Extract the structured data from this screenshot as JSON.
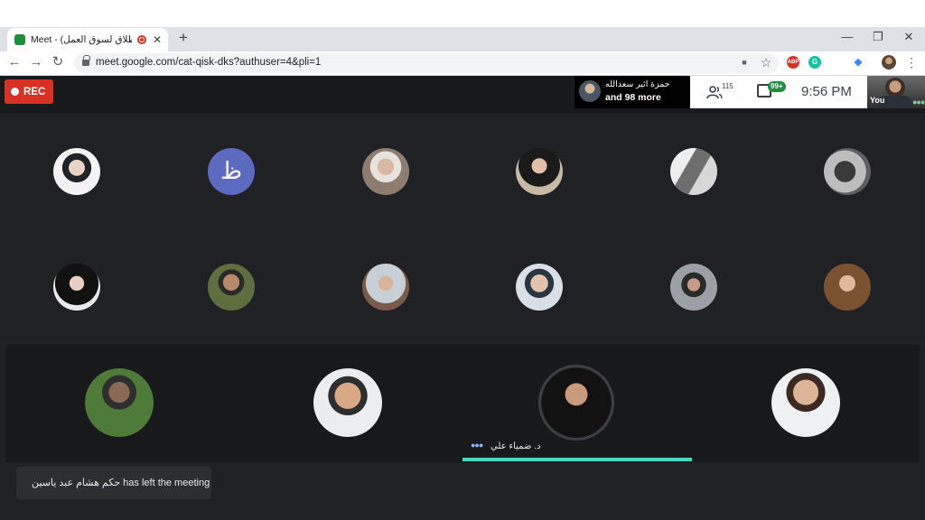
{
  "browser": {
    "tab_title": "Meet - (الانطلاق لسوق العمل)",
    "new_tab_label": "+",
    "url": "meet.google.com/cat-qisk-dks?authuser=4&pli=1",
    "window_controls": {
      "minimize": "—",
      "restore": "❐",
      "close": "✕"
    },
    "nav": {
      "back": "←",
      "forward": "→",
      "reload": "↻"
    },
    "omnibox_icons": {
      "camera": "■",
      "star": "☆"
    },
    "extensions": [
      {
        "name": "adblock-icon",
        "text": "ABP",
        "color": "#d93025"
      },
      {
        "name": "grammarly-icon",
        "text": "G",
        "color": "#15c39a"
      },
      {
        "name": "extension-icon",
        "text": "◆",
        "color": "#4285f4"
      }
    ]
  },
  "meet": {
    "rec_label": "REC",
    "presenter": {
      "name": "حمزة اثير سعدالله",
      "more": "and 98 more"
    },
    "participant_count": "115",
    "chat_badge": "99+",
    "time": "9:56  PM",
    "self_label": "You",
    "letter_avatar": "ظ",
    "speaker_name": "د. ضمياء علي",
    "toast_text": "حكم هشام عبد ياسين has left the meeting",
    "colors": {
      "accent_teal": "#4cd7c4",
      "rec_red": "#d93025",
      "chat_badge_green": "#1e8e3e",
      "letter_avatar": "#5c6bc0"
    }
  }
}
